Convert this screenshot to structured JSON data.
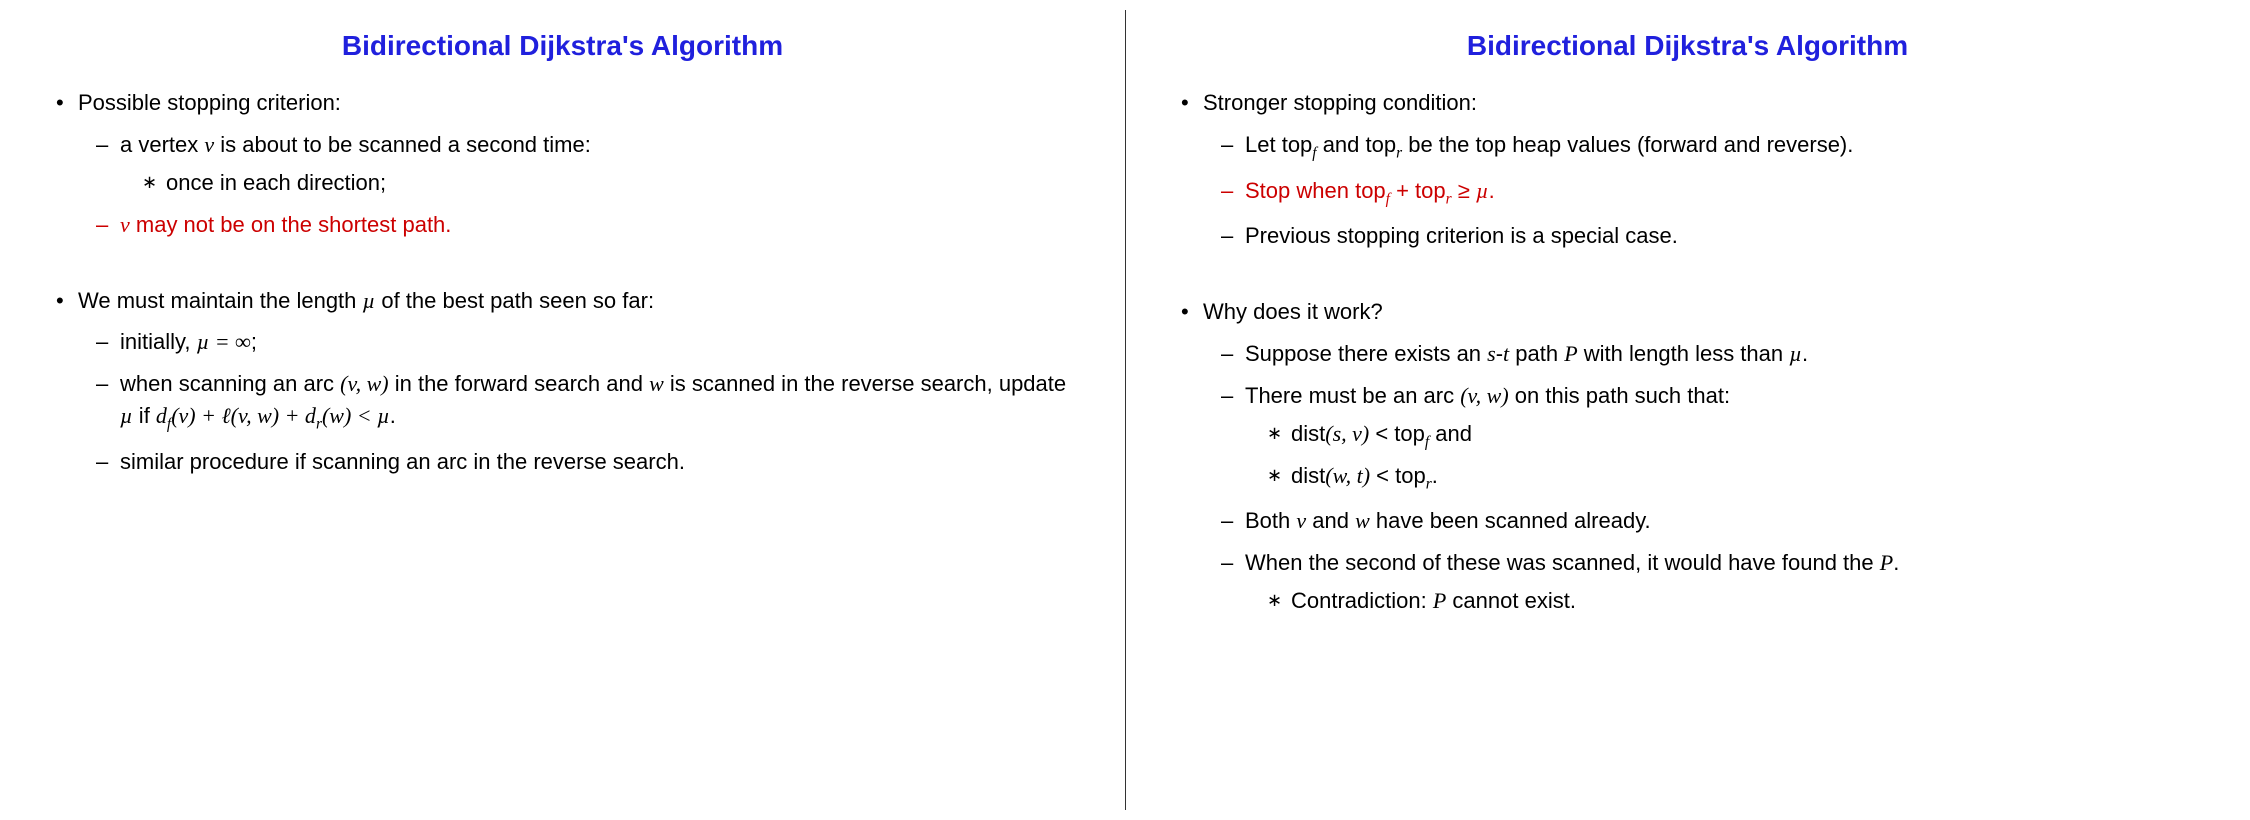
{
  "left": {
    "title": "Bidirectional Dijkstra's Algorithm",
    "b1": "Possible stopping criterion:",
    "b1s1_a": "a vertex ",
    "b1s1_v": "v",
    "b1s1_b": " is about to be scanned a second time:",
    "b1s1ss1": "once in each direction;",
    "b1s2_v": "v",
    "b1s2_b": " may not be on the shortest path.",
    "b2_a": "We must maintain the length ",
    "b2_mu": "µ",
    "b2_b": " of the best path seen so far:",
    "b2s1_a": "initially, ",
    "b2s1_eq": "µ = ∞",
    "b2s1_b": ";",
    "b2s2_a": "when scanning an arc ",
    "b2s2_arc": "(v, w)",
    "b2s2_b": " in the forward search and ",
    "b2s2_w": "w",
    "b2s2_c": " is scanned in the reverse search, update ",
    "b2s2_mu": "µ",
    "b2s2_d": " if ",
    "b2s2_cond": "d_f(v) + ℓ(v, w) + d_r(w) < µ",
    "b2s2_e": ".",
    "b2s3": "similar procedure if scanning an arc in the reverse search."
  },
  "right": {
    "title": "Bidirectional Dijkstra's Algorithm",
    "b1": "Stronger stopping condition:",
    "b1s1_a": "Let ",
    "b1s1_tf": "top_f",
    "b1s1_b": " and ",
    "b1s1_tr": "top_r",
    "b1s1_c": " be the top heap values (forward and reverse).",
    "b1s2_a": "Stop when ",
    "b1s2_cond": "top_f + top_r ≥ µ",
    "b1s2_b": ".",
    "b1s3": "Previous stopping criterion is a special case.",
    "b2": "Why does it work?",
    "b2s1_a": "Suppose there exists an ",
    "b2s1_s": "s",
    "b2s1_dash": "-",
    "b2s1_t": "t",
    "b2s1_b": " path ",
    "b2s1_P": "P",
    "b2s1_c": " with length less than ",
    "b2s1_mu": "µ",
    "b2s1_d": ".",
    "b2s2_a": "There must be an arc ",
    "b2s2_arc": "(v, w)",
    "b2s2_b": " on this path such that:",
    "b2s2ss1": "dist(s, v) < top_f",
    "b2s2ss1_and": " and",
    "b2s2ss2": "dist(w, t) < top_r",
    "b2s2ss2_dot": ".",
    "b2s3_a": "Both ",
    "b2s3_v": "v",
    "b2s3_b": " and ",
    "b2s3_w": "w",
    "b2s3_c": " have been scanned already.",
    "b2s4_a": "When the second of these was scanned, it would have found the ",
    "b2s4_P": "P",
    "b2s4_b": ".",
    "b2s4ss1_a": "Contradiction: ",
    "b2s4ss1_P": "P",
    "b2s4ss1_b": " cannot exist."
  }
}
